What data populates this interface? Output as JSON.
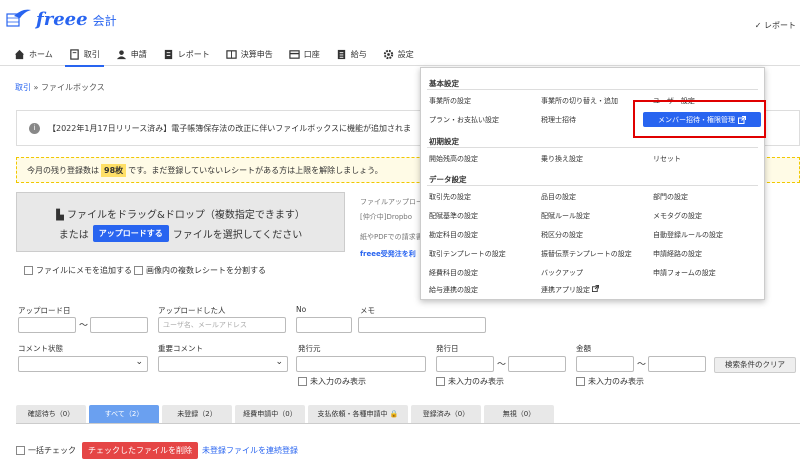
{
  "header": {
    "app_name": "freee",
    "app_sub": "会計",
    "right_text": "✓ レポート"
  },
  "nav": [
    {
      "label": "ホーム",
      "icon": "home-icon"
    },
    {
      "label": "取引",
      "icon": "book-icon"
    },
    {
      "label": "申請",
      "icon": "user-icon"
    },
    {
      "label": "レポート",
      "icon": "report-icon"
    },
    {
      "label": "決算申告",
      "icon": "ledger-icon"
    },
    {
      "label": "口座",
      "icon": "card-icon"
    },
    {
      "label": "給与",
      "icon": "doc-icon"
    },
    {
      "label": "設定",
      "icon": "gear-icon"
    }
  ],
  "breadcrumb": {
    "link": "取引",
    "sep": "»",
    "current": "ファイルボックス"
  },
  "notice": "【2022年1月17日リリース済み】電子帳簿保存法の改正に伴いファイルボックスに機能が追加されま",
  "quota": {
    "pre": "今月の残り登録数は",
    "count": "98枚",
    "post": "です。まだ登録していないレシートがある方は上限を解除しましょう。"
  },
  "dropzone": {
    "line1": "ファイルをドラッグ&ドロップ（複数指定できます）",
    "or": "または",
    "upload_button": "アップロードする",
    "line2_tail": "ファイルを選択してください"
  },
  "side": {
    "line1": "ファイルアップロー",
    "line2": "[仲介中]Dropbo",
    "line3": "紙やPDFでの請求書",
    "link": "freee受発注を利"
  },
  "options": {
    "memo": "ファイルにメモを追加する",
    "split": "画像内の複数レシートを分割する"
  },
  "filters": {
    "upload_date": "アップロード日",
    "uploader": "アップロードした人",
    "uploader_placeholder": "ユーザ名、メールアドレス",
    "no": "No",
    "memo": "メモ",
    "comment_status": "コメント状態",
    "important_comment": "重要コメント",
    "issuer": "発行元",
    "issue_date": "発行日",
    "amount": "金額",
    "unentered_only": "未入力のみ表示",
    "clear": "検索条件のクリア",
    "tilde": "〜"
  },
  "tabs": [
    {
      "label": "確認待ち（0）",
      "active": false
    },
    {
      "label": "すべて（2）",
      "active": true
    },
    {
      "label": "未登録（2）",
      "active": false
    },
    {
      "label": "経費申請中（0）",
      "active": false
    },
    {
      "label": "支払依頼・各種申請中 🔒",
      "active": false
    },
    {
      "label": "登録済み（0）",
      "active": false
    },
    {
      "label": "無視（0）",
      "active": false
    }
  ],
  "bulk": {
    "check_all": "一括チェック",
    "delete_button": "チェックしたファイルを削除",
    "continuous": "未登録ファイルを連続登録"
  },
  "settings_menu": {
    "basic": "基本設定",
    "basic_items": [
      "事業所の設定",
      "事業所の切り替え・追加",
      "ユーザー設定",
      "プラン・お支払い設定",
      "税理士招待"
    ],
    "member_button": "メンバー招待・権限管理",
    "initial": "初期設定",
    "initial_items": [
      "開始残高の設定",
      "乗り換え設定",
      "リセット"
    ],
    "data": "データ設定",
    "data_items": [
      "取引先の設定",
      "品目の設定",
      "部門の設定",
      "配賦基準の設定",
      "配賦ルール設定",
      "メモタグの設定",
      "勘定科目の設定",
      "税区分の設定",
      "自動登録ルールの設定",
      "取引テンプレートの設定",
      "振替伝票テンプレートの設定",
      "申請経路の設定",
      "経費科目の設定",
      "バックアップ",
      "申請フォームの設定",
      "給与連携の設定",
      "連携アプリ設定"
    ]
  },
  "colors": {
    "brand": "#2864f0",
    "danger": "#e54545",
    "highlight": "#e00000"
  }
}
